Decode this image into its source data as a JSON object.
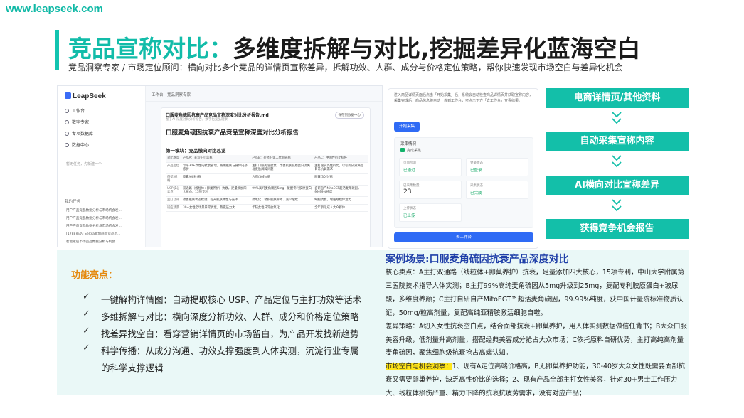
{
  "site_url": "www.leapseek.com",
  "header": {
    "title_accent": "竞品宣称对比：",
    "title_main": "多维度拆解与对比,挖掘差异化蓝海空白",
    "subtitle": "竞品洞察专家 / 市场定位顾问：横向对比多个竞品的详情页宣称差异，拆解功效、人群、成分与价格定位策略，帮你快速发现市场空白与差异化机会"
  },
  "app": {
    "logo": "LeapSeek",
    "top_tabs": [
      "工作台",
      "竞品洞察专家"
    ],
    "nav": [
      "工作台",
      "数字专家",
      "专项数据库",
      "数据中心"
    ],
    "side_note": "暂无任务，先新建一个",
    "history_title": "我的任务",
    "history": [
      "用户产品竞品数据分析与市场机会发...",
      "用户产品竞品数据分析与市场机会发...",
      "用户产品竞品数据分析与市场机会发...",
      "[1788商品] Seltsa新增商品竞品对...",
      "智能家居市场竞品数据分析与机会..."
    ],
    "doc": {
      "file": "口服麦角硫因抗衰产品竞品宣称深度对比分析报告.md",
      "sub": "基于AI 深度对比分析报告，数字化竞品洞察",
      "save_btn": "保存到数据中心",
      "title": "口服麦角硫因抗衰产品竞品宣称深度对比分析报告",
      "section": "第一模块：竞品横向对比总览",
      "headers": [
        "对比维度",
        "产品A：某双护小蓝瓶",
        "产品B：某修护第二代超光瓶",
        "产品C：中国性价比标杆"
      ],
      "rows": [
        [
          "产品定位",
          "专研30+女性的抗衰管理，兼顾肌肤与身体内部修护",
          "主打口服美容抗衰，改善肌肤胶原蛋白流失与皮肤屏障问题",
          "主打国货高性价比，以较优成分满足日常抗氧需求"
        ],
        [
          "剂型/规格",
          "胶囊/60粒/瓶",
          "片剂/30粒/瓶",
          "胶囊/30粒/瓶"
        ],
        [
          "USP核心卖点",
          "双通路（线粒体+卵巢养护）抗衰，足量添加四大核心，15项专利",
          "99%高纯麦角硫因5mg，复配专利胶原蛋白",
          "自研自产MitoEGT超活麦角硫因，99.99%纯度"
        ],
        [
          "主打功效",
          "改善肌肤状态松弛，提升肌肤弹性与光泽",
          "抗氧化、修护肌肤屏障、减少皱纹",
          "细胞抗衰，增强线粒体活力"
        ],
        [
          "适应场景",
          "30+女性全场景日常抗衰，熬夜压力大",
          "年轻女性日常抗氧化",
          "全年龄段成人大众群体"
        ]
      ]
    },
    "panel": {
      "desc": "进入商品详情页面后点击「开始采集」后，系统会自动检查商品详情页并获取宣称内容，采集完成后，商品信息将自动上传到工作台，可点击下方「去工作台」查看结果。",
      "start_btn": "开始采集",
      "status_title": "采集情况",
      "status_check": "完成采集",
      "cards": [
        {
          "k": "页面检测",
          "v": "已通过"
        },
        {
          "k": "登录状态",
          "v": "已登录"
        },
        {
          "k": "已采集数量",
          "v": "23"
        },
        {
          "k": "采集状态",
          "v": "已完成"
        },
        {
          "k": "上传状态",
          "v": "已上传"
        }
      ],
      "bottom_btn": "去工作台"
    }
  },
  "flow": [
    "电商详情页/其他资料",
    "自动采集宣称内容",
    "AI横向对比宣称差异",
    "获得竞争机会报告"
  ],
  "features": {
    "title": "功能亮点：",
    "items": [
      "一键解构详情图：自动提取核心 USP、产品定位与主打功效等话术",
      "多维拆解与对比：横向深度分析功效、人群、成分和价格定位策略",
      "找差异找空白：看穿营销详情页的市场留白，为产品开发找新趋势",
      "科学传播：从成分沟通、功效支撑强度到人体实测，沉淀行业专属",
      "的科学支撑逻辑"
    ]
  },
  "case": {
    "title": "案例场景:口服麦角硫因抗衰产品深度对比",
    "p1": "核心卖点：A主打双通路（线粒体+卵巢养护）抗衰，足量添加四大核心，15项专利，中山大学附属第三医院技术指导人体实测；B主打99%高纯麦角硫因从5mg升级到25mg，复配专利胶原蛋白+玻尿酸，多维度养颜；C主打自研自产MitoEGT™超活麦角硫因，99.99%纯度，获中国计量院标准物质认证，50mg/粒高剂量，复配高纯亚精胺激活细胞自噬。",
    "p2": "差异策略：A切入女性抗衰空白点，结合面部抗衰+卵巢养护，用人体实测数据做信任背书；B大众口服美容升级，低剂量升高剂量，搭配经典美容成分抢占大众市场；C依托原料自研优势，主打高纯高剂量麦角硫因，聚焦细胞级抗衰抢占高端认知。",
    "p3_label": "市场空白与机会洞察：",
    "p3": "1、现有A定位高端价格高，B无卵巢养护功能，30-40岁大众女性既需要面部抗衰又需要卵巢养护，缺乏高性价比的选择；2、现有产品全部主打女性美容，针对30+男士工作压力大、线粒体损伤严重、精力下降的抗衰抗疲劳需求，没有对应产品；"
  }
}
